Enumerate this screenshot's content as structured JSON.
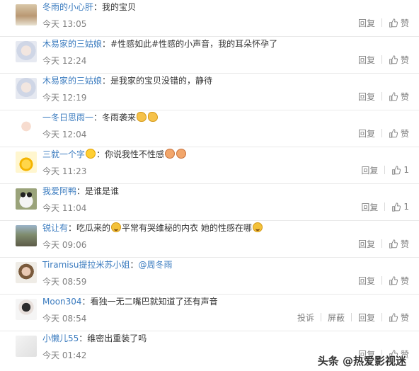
{
  "labels": {
    "reply": "回复",
    "like": "赞",
    "report": "投诉",
    "block": "屏蔽"
  },
  "colors": {
    "username": "#3a7bbf",
    "meta": "#808080",
    "divider": "#e9e9e9"
  },
  "comments": [
    {
      "user": "冬雨的小心肝",
      "sep": "：",
      "text": "我的宝贝",
      "time": "今天 13:05",
      "likes": ""
    },
    {
      "user": "木易家的三姑娘",
      "sep": "：",
      "text": "#性感如此#性感的小声音，我的耳朵怀孕了",
      "time": "今天 12:24",
      "likes": ""
    },
    {
      "user": "木易家的三姑娘",
      "sep": "：",
      "text": "是我家的宝贝没错的，静待",
      "time": "今天 12:19",
      "likes": ""
    },
    {
      "user": "一冬日思雨一",
      "sep": "：",
      "text": "冬雨袭来",
      "time": "今天 12:04",
      "likes": ""
    },
    {
      "user": "三就一个字",
      "sep": "：",
      "text": "你说我性不性感",
      "time": "今天 11:23",
      "likes": "1"
    },
    {
      "user": "我爱阿鸭",
      "sep": "：",
      "text": "是谁是谁",
      "time": "今天 11:04",
      "likes": "1"
    },
    {
      "user": "锐让有",
      "sep": "：",
      "text": "吃瓜来的",
      "text2": "平常有哭维秘的内衣 她的性感在哪",
      "time": "今天 09:06",
      "likes": ""
    },
    {
      "user": "Tiramisu提拉米苏小姐",
      "sep": "：",
      "mention": "@周冬雨",
      "text": "",
      "time": "今天 08:59",
      "likes": ""
    },
    {
      "user": "Moon304",
      "sep": "：",
      "text": "看独一无二嘴巴就知道了还有声音",
      "time": "今天 08:54",
      "likes": ""
    },
    {
      "user": "小懒儿55",
      "sep": "：",
      "text": "维密出重装了吗",
      "time": "今天 01:42",
      "likes": ""
    }
  ],
  "watermark": "头条 @热爱影视迷"
}
